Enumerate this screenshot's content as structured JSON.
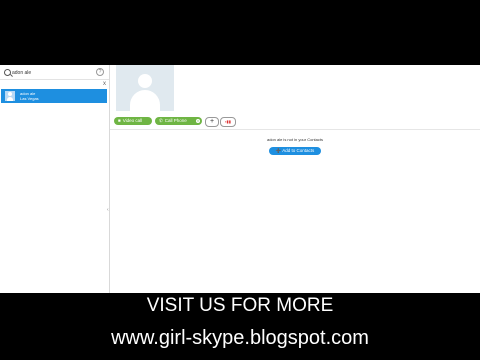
{
  "sidebar": {
    "search": {
      "value": "adon ale"
    },
    "help_icon_label": "?",
    "clear_label": "x",
    "result": {
      "name": "adon ale",
      "location": "Las Vegas"
    },
    "collapse_label": "‹"
  },
  "main": {
    "toolbar": {
      "video_label": "Video call",
      "video_icon": "■",
      "phone_label": "Call Phone",
      "phone_icon": "✆",
      "caret_label": "▾",
      "plus_label": "+",
      "signal_label": "▪▮▮"
    },
    "notice": "adon ale is not in your Contacts",
    "add_button_label": "➕ Add to Contacts"
  },
  "colors": {
    "brand_blue": "#1e8fe0",
    "call_green": "#6fb544"
  },
  "promo": {
    "line1": "VISIT US FOR MORE",
    "line2": "www.girl-skype.blogspot.com"
  }
}
